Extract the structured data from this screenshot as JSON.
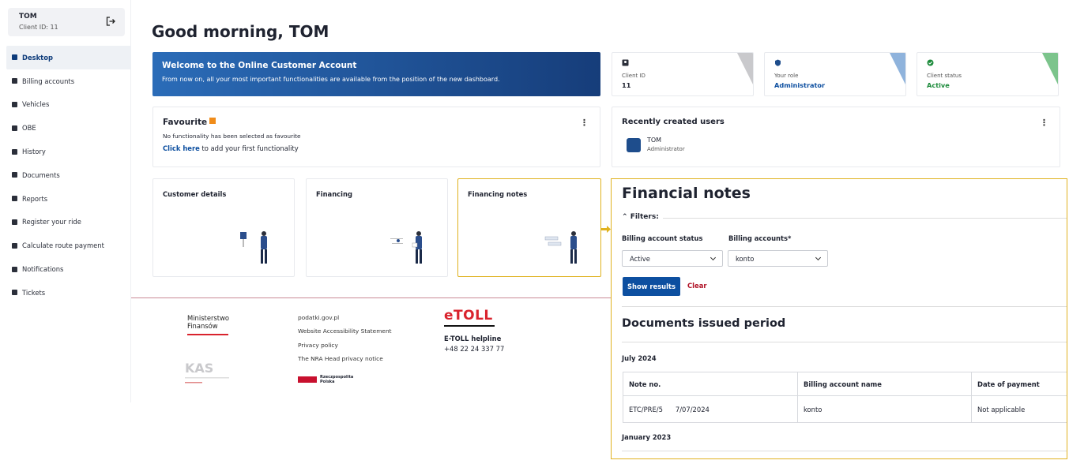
{
  "user": {
    "name": "TOM",
    "client_id": "Client ID: 11"
  },
  "nav": [
    {
      "label": "Desktop",
      "icon": "home-icon",
      "active": true
    },
    {
      "label": "Billing accounts",
      "icon": "billing-icon"
    },
    {
      "label": "Vehicles",
      "icon": "truck-icon"
    },
    {
      "label": "OBE",
      "icon": "device-icon"
    },
    {
      "label": "History",
      "icon": "clock-icon"
    },
    {
      "label": "Documents",
      "icon": "document-icon"
    },
    {
      "label": "Reports",
      "icon": "reports-icon"
    },
    {
      "label": "Register your ride",
      "icon": "register-icon"
    },
    {
      "label": "Calculate route payment",
      "icon": "calculator-icon"
    },
    {
      "label": "Notifications",
      "icon": "bell-icon"
    },
    {
      "label": "Tickets",
      "icon": "ticket-icon"
    }
  ],
  "greeting": "Good morning, TOM",
  "welcome": {
    "title": "Welcome to the Online Customer Account",
    "text": "From now on, all your most important functionalities are available from the position of the new dashboard."
  },
  "info_cards": [
    {
      "label": "Client ID",
      "value": "11",
      "value_color": "#1f2330",
      "accent": "#c9c9cc"
    },
    {
      "label": "Your role",
      "value": "Administrator",
      "value_color": "#0d4fa0",
      "accent": "#8fb3dc"
    },
    {
      "label": "Client status",
      "value": "Active",
      "value_color": "#1b8a3a",
      "accent": "#7cc48c"
    }
  ],
  "favourite": {
    "title": "Favourite",
    "message": "No functionality has been selected as favourite",
    "link": "Click here",
    "link_suffix": " to add your first functionality"
  },
  "recent_users": {
    "title": "Recently created users",
    "name": "TOM",
    "role": "Administrator"
  },
  "tiles": [
    {
      "title": "Customer details"
    },
    {
      "title": "Financing"
    },
    {
      "title": "Financing notes"
    }
  ],
  "footer": {
    "ministry": "Ministerstwo\nFinansów",
    "kas": "Krajowa Administracja Skarbowa",
    "links": [
      "podatki.gov.pl",
      "Website Accessibility Statement",
      "Privacy policy",
      "The NRA Head privacy notice"
    ],
    "rp": "Rzeczpospolita Polska",
    "etoll_logo": "eTOLL",
    "helpline_label": "E-TOLL helpline",
    "helpline_phone": "+48 22 24 337 77"
  },
  "financial_notes": {
    "title": "Financial notes",
    "filters_label": "Filters:",
    "billing_status_label": "Billing account status",
    "billing_status_value": "Active",
    "billing_accounts_label": "Billing accounts*",
    "billing_accounts_value": "konto",
    "show_button": "Show results",
    "clear_button": "Clear",
    "docs_title": "Documents issued period",
    "month1": "July 2024",
    "month2": "January 2023",
    "columns": [
      "Note no.",
      "Billing account name",
      "Date of payment"
    ],
    "rows": [
      {
        "note": "ETC/PRE/5",
        "date": "7/07/2024",
        "account": "konto",
        "payment": "Not applicable"
      }
    ]
  }
}
